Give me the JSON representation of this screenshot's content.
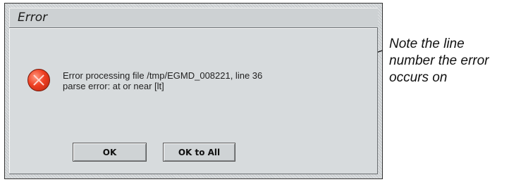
{
  "dialog": {
    "title": "Error",
    "message_line1": "Error processing file /tmp/EGMD_008221, line 36",
    "message_line2": "parse error: at or near [lt]",
    "icon": "error-icon",
    "buttons": {
      "ok_label": "OK",
      "ok_all_label": "OK to All"
    }
  },
  "annotation": {
    "line1": "Note the line",
    "line2": "number the error",
    "line3": "occurs on"
  }
}
